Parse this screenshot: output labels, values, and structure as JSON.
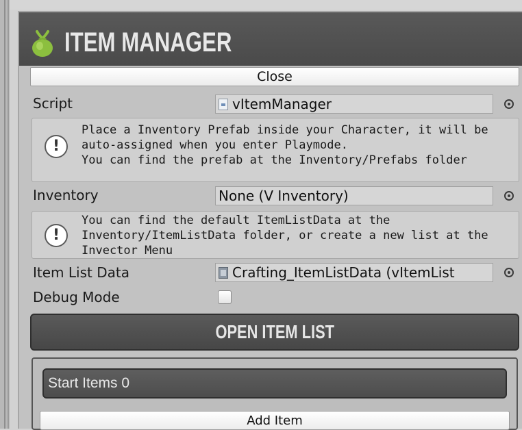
{
  "header": {
    "title": "ITEM MANAGER",
    "logo_icon": "green-bag-icon",
    "close_label": "Close"
  },
  "fields": {
    "script": {
      "label": "Script",
      "value": "vItemManager",
      "icon": "script-icon"
    },
    "inventory": {
      "label": "Inventory",
      "value": "None (V Inventory)"
    },
    "item_list_data": {
      "label": "Item List Data",
      "value": "Crafting_ItemListData (vItemList",
      "icon": "scriptable-object-icon"
    },
    "debug_mode": {
      "label": "Debug Mode",
      "checked": false
    }
  },
  "help": {
    "inventory_prefab": {
      "lines": [
        "Place a Inventory Prefab inside your Character, it will be",
        "auto-assigned when you enter Playmode.",
        "You can find the prefab at the Inventory/Prefabs folder"
      ]
    },
    "item_list_data": {
      "lines": [
        "You can find the default ItemListData at the",
        "Inventory/ItemListData folder, or create a new list at the",
        "Invector Menu"
      ]
    }
  },
  "actions": {
    "open_item_list": "OPEN ITEM LIST",
    "start_items": "Start Items 0",
    "add_item": "Add Item"
  },
  "colors": {
    "title_bar": "#4f4f4f",
    "panel_bg": "#c2c2c2",
    "logo_green": "#8cbf3f"
  }
}
